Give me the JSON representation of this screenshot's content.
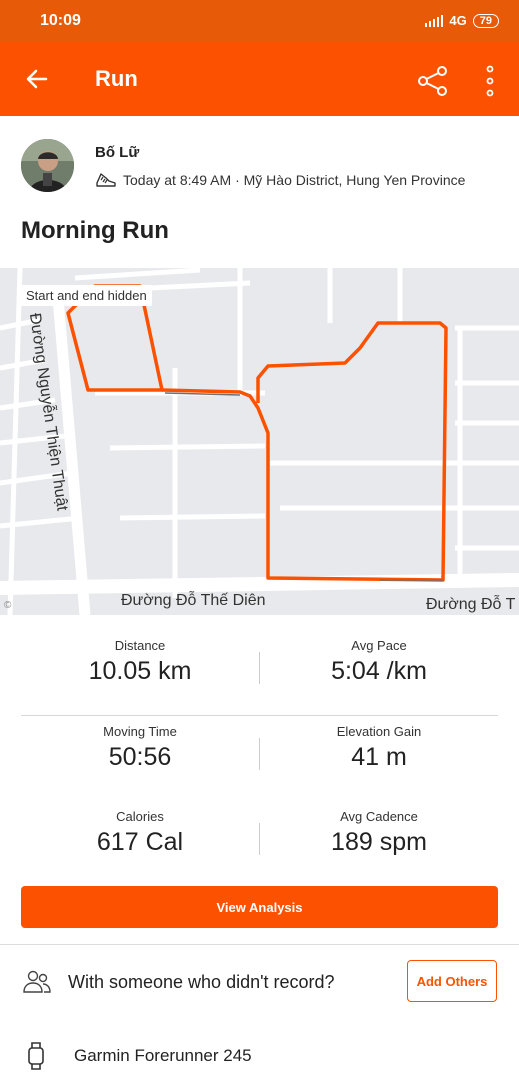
{
  "status": {
    "time": "10:09",
    "network": "4G",
    "battery": "79"
  },
  "appbar": {
    "title": "Run",
    "back_icon": "arrow-left-icon",
    "share_icon": "share-icon",
    "more_icon": "more-vertical-icon"
  },
  "athlete": {
    "name": "Bố Lữ",
    "meta": "Today at 8:49 AM · Mỹ Hào District, Hung Yen Province",
    "sport_icon": "shoe-icon"
  },
  "activity": {
    "title": "Morning Run"
  },
  "map": {
    "hidden_label": "Start and end hidden",
    "road_vertical": "Đường Nguyễn Thiện Thuật",
    "road_bottom_1": "Đường Đỗ Thế Diên",
    "road_bottom_2": "Đường Đỗ T",
    "route_color": "#fc5200"
  },
  "stats": [
    {
      "label": "Distance",
      "value": "10.05 km"
    },
    {
      "label": "Avg Pace",
      "value": "5:04 /km"
    },
    {
      "label": "Moving Time",
      "value": "50:56"
    },
    {
      "label": "Elevation Gain",
      "value": "41 m"
    },
    {
      "label": "Calories",
      "value": "617 Cal"
    },
    {
      "label": "Avg Cadence",
      "value": "189 spm"
    }
  ],
  "actions": {
    "view_analysis": "View Analysis",
    "others_prompt": "With someone who didn't record?",
    "add_others": "Add Others"
  },
  "device": {
    "name": "Garmin Forerunner 245",
    "icon": "watch-icon"
  },
  "colors": {
    "brand": "#fc5200",
    "status_bar": "#e65a08"
  }
}
